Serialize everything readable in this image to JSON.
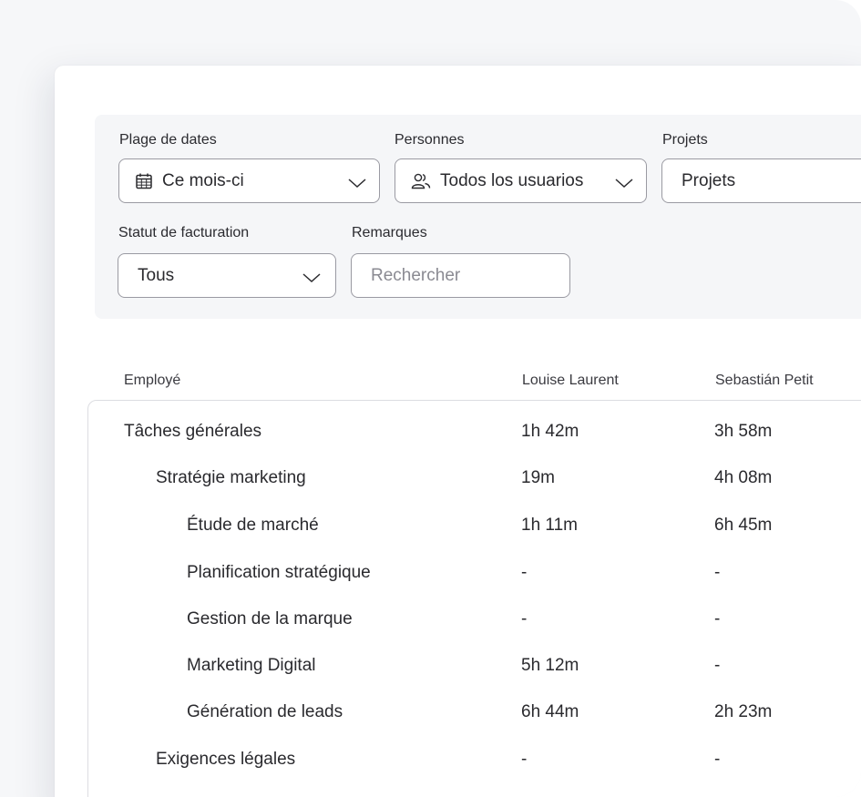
{
  "filters": {
    "date_range": {
      "label": "Plage de dates",
      "value": "Ce mois-ci"
    },
    "people": {
      "label": "Personnes",
      "value": "Todos los usuarios"
    },
    "projects": {
      "label": "Projets",
      "value": "Projets"
    },
    "billing_status": {
      "label": "Statut de facturation",
      "value": "Tous"
    },
    "remarks": {
      "label": "Remarques",
      "placeholder": "Rechercher"
    }
  },
  "table": {
    "header": {
      "label": "Employé",
      "columns": [
        "Louise Laurent",
        "Sebastián Petit"
      ]
    },
    "rows": [
      {
        "label": "Tâches générales",
        "level": 0,
        "values": [
          "1h 42m",
          "3h 58m"
        ]
      },
      {
        "label": "Stratégie marketing",
        "level": 1,
        "values": [
          "19m",
          "4h 08m"
        ]
      },
      {
        "label": "Étude de marché",
        "level": 2,
        "values": [
          "1h 11m",
          "6h 45m"
        ]
      },
      {
        "label": "Planification stratégique",
        "level": 2,
        "values": [
          "-",
          "-"
        ]
      },
      {
        "label": "Gestion de la marque",
        "level": 2,
        "values": [
          "-",
          "-"
        ]
      },
      {
        "label": "Marketing Digital",
        "level": 2,
        "values": [
          "5h 12m",
          "-"
        ]
      },
      {
        "label": "Génération de leads",
        "level": 2,
        "values": [
          "6h 44m",
          "2h 23m"
        ]
      },
      {
        "label": "Exigences légales",
        "level": 1,
        "values": [
          "-",
          "-"
        ]
      }
    ]
  },
  "icons": {
    "date": "calendar-icon",
    "people": "users-icon",
    "dropdown": "chevron-down-icon"
  }
}
